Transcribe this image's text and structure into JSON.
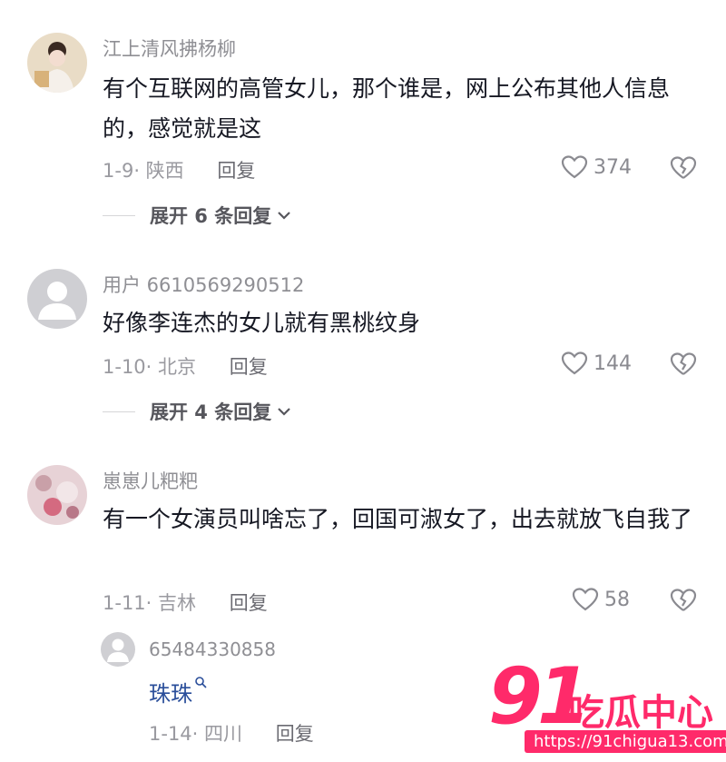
{
  "comments": [
    {
      "username": "江上清风拂杨柳",
      "content": "有个互联网的高管女儿，那个谁是，网上公布其他人信息的，感觉就是这",
      "date": "1-9",
      "location": "陕西",
      "reply_label": "回复",
      "likes": "374",
      "expand_label": "展开 6 条回复"
    },
    {
      "username": "用户 6610569290512",
      "content": "好像李连杰的女儿就有黑桃纹身",
      "date": "1-10",
      "location": "北京",
      "reply_label": "回复",
      "likes": "144",
      "expand_label": "展开 4 条回复"
    },
    {
      "username": "崽崽儿粑粑",
      "content": "有一个女演员叫啥忘了，回国可淑女了，出去就放飞自我了",
      "date": "1-11",
      "location": "吉林",
      "reply_label": "回复",
      "likes": "58"
    }
  ],
  "sub_reply": {
    "username": "65484330858",
    "content": "珠珠",
    "date": "1-14",
    "location": "四川",
    "reply_label": "回复"
  },
  "watermark": {
    "number": "91",
    "text": "吃瓜中心",
    "url": "https://91chigua13.com"
  },
  "colors": {
    "text": "#161823",
    "meta": "#9a9aa0",
    "link": "#2a4e9a",
    "watermark": "#ff2a6a"
  }
}
